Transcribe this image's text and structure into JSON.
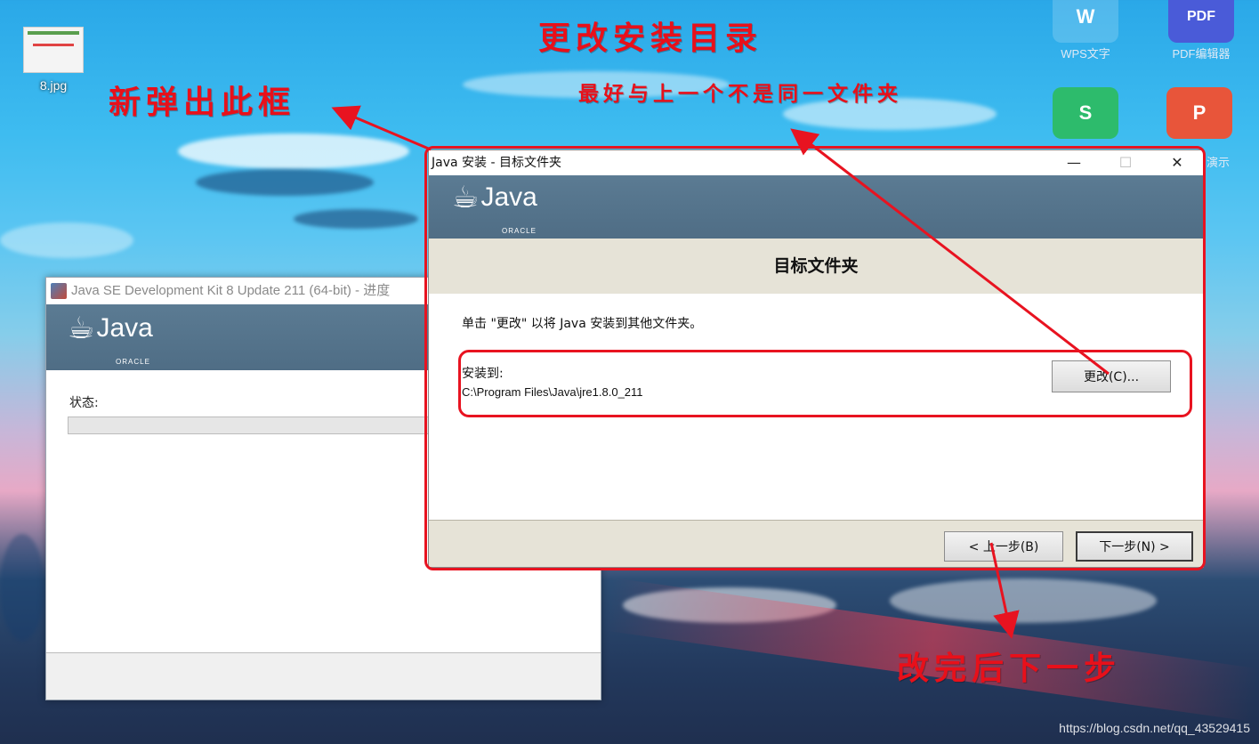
{
  "desktop": {
    "file_icon_label": "8.jpg",
    "apps": [
      {
        "label": "WPS文字",
        "glyph": "W",
        "color": "#3a7bd5"
      },
      {
        "label": "PDF编辑器",
        "glyph": "PDF",
        "color": "#4a5bd8"
      },
      {
        "label": "",
        "glyph": "S",
        "color": "#2dbb6c"
      },
      {
        "label": "演示",
        "glyph": "P",
        "color": "#e8553a"
      }
    ],
    "watermark": "https://blog.csdn.net/qq_43529415"
  },
  "annotations": {
    "title": "更改安装目录",
    "subtitle": "最好与上一个不是同一文件夹",
    "new_popup": "新弹出此框",
    "after_change": "改完后下一步",
    "color": "#e81320"
  },
  "back_window": {
    "title": "Java SE Development Kit 8 Update 211 (64-bit) - 进度",
    "logo_text": "Java",
    "oracle": "ORACLE",
    "status_label": "状态:"
  },
  "front_window": {
    "title": "Java 安装 - 目标文件夹",
    "minimize": "—",
    "maximize": "☐",
    "close": "✕",
    "logo_text": "Java",
    "oracle": "ORACLE",
    "heading": "目标文件夹",
    "instruction": "单击 \"更改\" 以将 Java 安装到其他文件夹。",
    "install_to_label": "安装到:",
    "install_path": "C:\\Program Files\\Java\\jre1.8.0_211",
    "change_button": "更改(C)...",
    "back_button": "< 上一步(B)",
    "next_button": "下一步(N) >"
  }
}
